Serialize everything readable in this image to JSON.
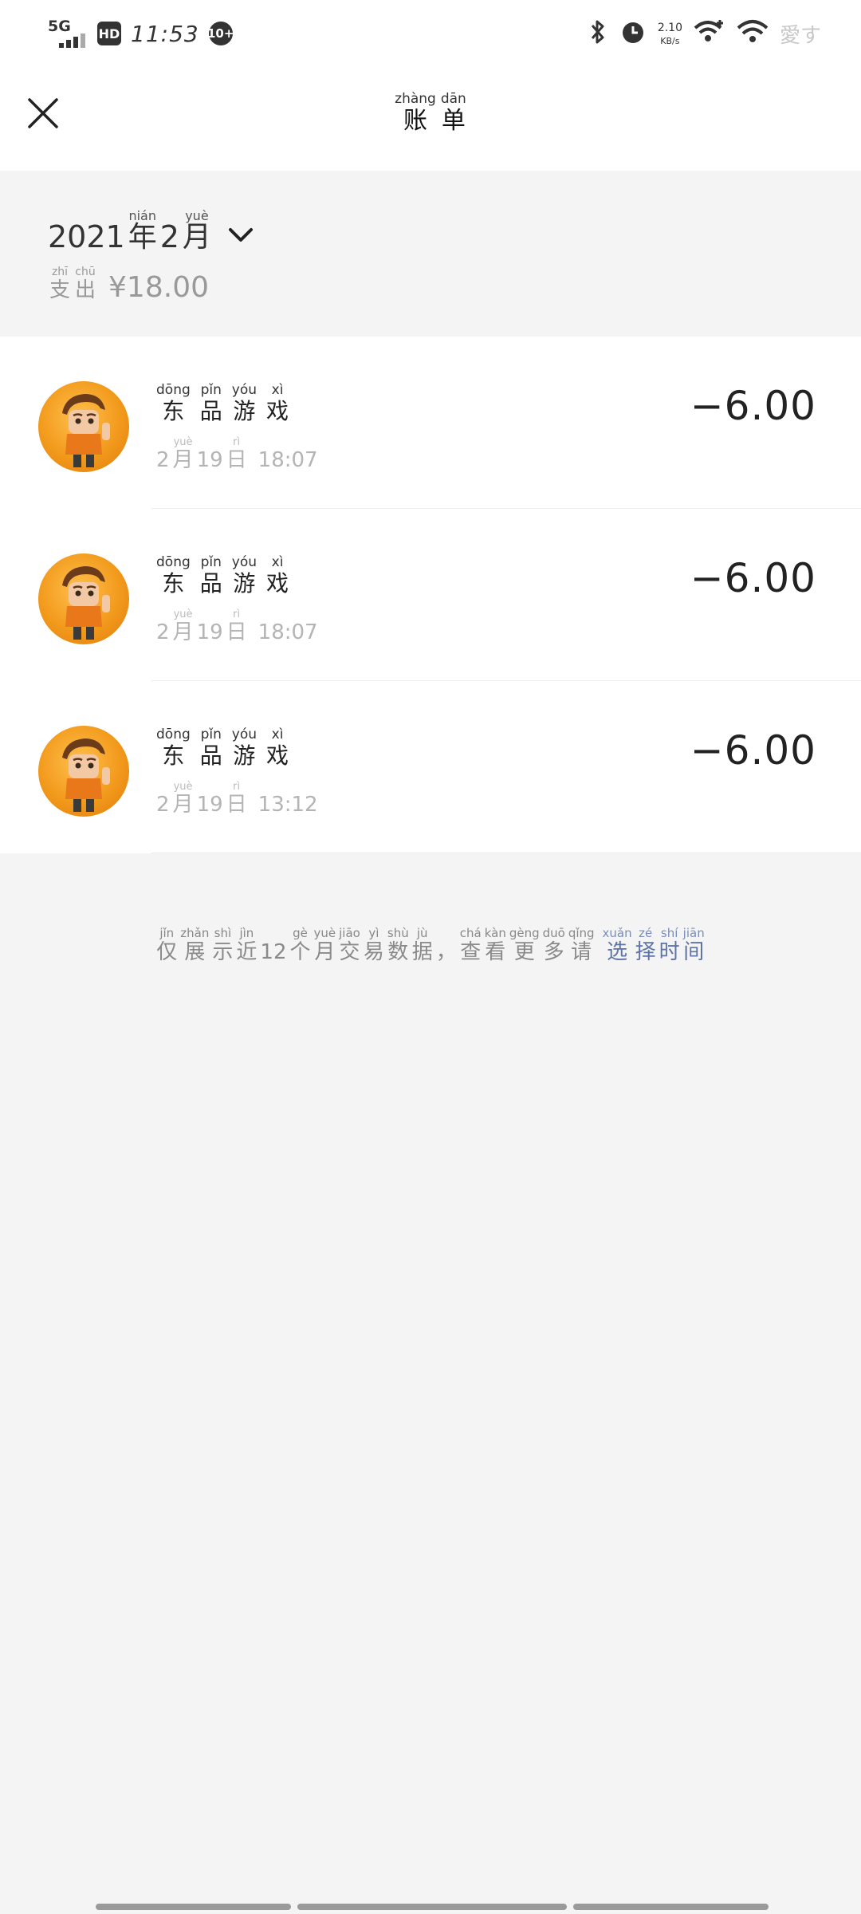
{
  "status_bar": {
    "network": "5G",
    "hd": "HD",
    "time": "11:53",
    "notif_count": "10+",
    "net_speed_value": "2.10",
    "net_speed_unit": "KB/s",
    "extra_text": "愛す"
  },
  "nav": {
    "title_chars": [
      {
        "py": "zhàng",
        "hz": "账"
      },
      {
        "py": "dān",
        "hz": "单"
      }
    ]
  },
  "month_summary": {
    "year": "2021",
    "year_char": {
      "py": "nián",
      "hz": "年"
    },
    "month": "2",
    "month_char": {
      "py": "yuè",
      "hz": "月"
    },
    "expense_label": [
      {
        "py": "zhī",
        "hz": "支"
      },
      {
        "py": "chū",
        "hz": "出"
      }
    ],
    "expense_amount": "¥18.00"
  },
  "transactions": [
    {
      "name": [
        {
          "py": "dōng",
          "hz": "东"
        },
        {
          "py": "pǐn",
          "hz": "品"
        },
        {
          "py": "yóu",
          "hz": "游"
        },
        {
          "py": "xì",
          "hz": "戏"
        }
      ],
      "month": "2",
      "month_char": {
        "py": "yuè",
        "hz": "月"
      },
      "day": "19",
      "day_char": {
        "py": "rì",
        "hz": "日"
      },
      "time": "18:07",
      "amount": "−6.00"
    },
    {
      "name": [
        {
          "py": "dōng",
          "hz": "东"
        },
        {
          "py": "pǐn",
          "hz": "品"
        },
        {
          "py": "yóu",
          "hz": "游"
        },
        {
          "py": "xì",
          "hz": "戏"
        }
      ],
      "month": "2",
      "month_char": {
        "py": "yuè",
        "hz": "月"
      },
      "day": "19",
      "day_char": {
        "py": "rì",
        "hz": "日"
      },
      "time": "18:07",
      "amount": "−6.00"
    },
    {
      "name": [
        {
          "py": "dōng",
          "hz": "东"
        },
        {
          "py": "pǐn",
          "hz": "品"
        },
        {
          "py": "yóu",
          "hz": "游"
        },
        {
          "py": "xì",
          "hz": "戏"
        }
      ],
      "month": "2",
      "month_char": {
        "py": "yuè",
        "hz": "月"
      },
      "day": "19",
      "day_char": {
        "py": "rì",
        "hz": "日"
      },
      "time": "13:12",
      "amount": "−6.00"
    }
  ],
  "notice": {
    "prefix": [
      {
        "py": "jǐn",
        "hz": "仅"
      },
      {
        "py": "zhǎn",
        "hz": "展"
      },
      {
        "py": "shì",
        "hz": "示"
      },
      {
        "py": "jìn",
        "hz": "近"
      }
    ],
    "number": "12",
    "middle": [
      {
        "py": "gè",
        "hz": "个"
      },
      {
        "py": "yuè",
        "hz": "月"
      },
      {
        "py": "jiāo",
        "hz": "交"
      },
      {
        "py": "yì",
        "hz": "易"
      },
      {
        "py": "shù",
        "hz": "数"
      },
      {
        "py": "jù",
        "hz": "据"
      }
    ],
    "comma": "，",
    "suffix": [
      {
        "py": "chá",
        "hz": "查"
      },
      {
        "py": "kàn",
        "hz": "看"
      },
      {
        "py": "gèng",
        "hz": "更"
      },
      {
        "py": "duō",
        "hz": "多"
      },
      {
        "py": "qǐng",
        "hz": "请"
      }
    ],
    "link": [
      {
        "py": "xuǎn",
        "hz": "选"
      },
      {
        "py": "zé",
        "hz": "择"
      },
      {
        "py": "shí",
        "hz": "时"
      },
      {
        "py": "jiān",
        "hz": "间"
      }
    ]
  },
  "colors": {
    "link": "#5e73a8",
    "avatar_orange": "#f29a1c"
  }
}
